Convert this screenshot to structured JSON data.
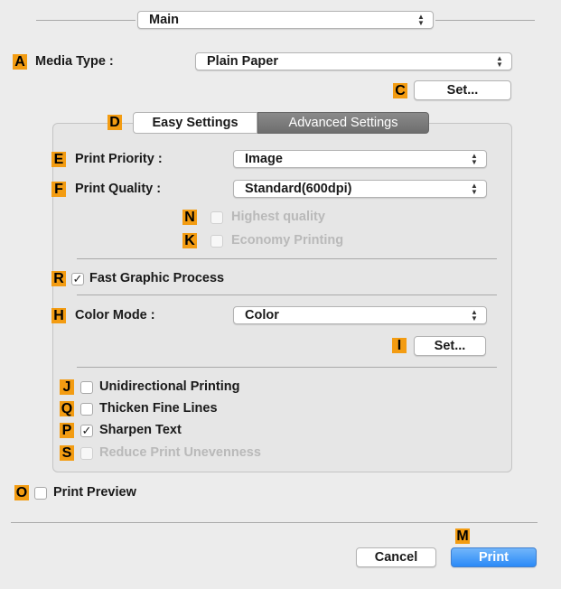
{
  "colors": {
    "badge": "#f39c12",
    "accent": "#2b8af7"
  },
  "top": {
    "preset_value": "Main"
  },
  "media": {
    "badge": "A",
    "label": "Media Type :",
    "value": "Plain Paper"
  },
  "set_c": {
    "badge": "C",
    "label": "Set..."
  },
  "tabs": {
    "badge": "D",
    "easy": "Easy Settings",
    "advanced": "Advanced Settings",
    "active": "Advanced Settings"
  },
  "print_priority": {
    "badge": "E",
    "label": "Print Priority :",
    "value": "Image"
  },
  "print_quality": {
    "badge": "F",
    "label": "Print Quality :",
    "value": "Standard(600dpi)"
  },
  "highest_quality": {
    "badge": "N",
    "label": "Highest quality",
    "checked": false,
    "enabled": false
  },
  "economy_printing": {
    "badge": "K",
    "label": "Economy Printing",
    "checked": false,
    "enabled": false
  },
  "fast_graphic": {
    "badge": "R",
    "label": "Fast Graphic Process",
    "checked": true
  },
  "color_mode": {
    "badge": "H",
    "label": "Color Mode :",
    "value": "Color"
  },
  "set_i": {
    "badge": "I",
    "label": "Set..."
  },
  "unidirectional": {
    "badge": "J",
    "label": "Unidirectional Printing",
    "checked": false
  },
  "thicken_lines": {
    "badge": "Q",
    "label": "Thicken Fine Lines",
    "checked": false
  },
  "sharpen_text": {
    "badge": "P",
    "label": "Sharpen Text",
    "checked": true
  },
  "reduce_unevenness": {
    "badge": "S",
    "label": "Reduce Print Unevenness",
    "checked": false,
    "enabled": false
  },
  "print_preview": {
    "badge": "O",
    "label": "Print Preview",
    "checked": false
  },
  "footer": {
    "print_badge": "M",
    "cancel": "Cancel",
    "print": "Print"
  },
  "icons": {
    "checkmark": "✓",
    "popup_arrows": "⌃⌄"
  }
}
